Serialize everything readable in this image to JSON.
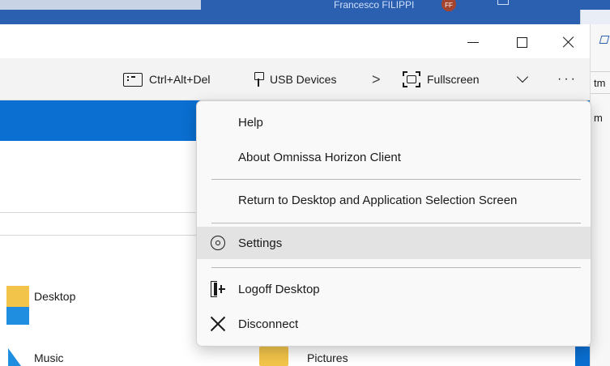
{
  "background": {
    "user_name": "Francesco FILIPPI",
    "avatar_initials": "FF"
  },
  "window": {
    "controls": {
      "minimize": "minimize",
      "maximize": "maximize",
      "close": "close"
    }
  },
  "toolbar": {
    "ctrl_alt_del": "Ctrl+Alt+Del",
    "usb_devices": "USB Devices",
    "separator": ">",
    "fullscreen": "Fullscreen",
    "more": "···"
  },
  "menu": {
    "items": [
      {
        "label": "Help"
      },
      {
        "label": "About Omnissa Horizon Client"
      },
      {
        "label": "Return to Desktop and Application Selection Screen"
      },
      {
        "label": "Settings",
        "icon": "gear-icon",
        "highlighted": true
      },
      {
        "label": "Logoff Desktop",
        "icon": "logoff-icon"
      },
      {
        "label": "Disconnect",
        "icon": "close-icon"
      }
    ]
  },
  "remote_desktop": {
    "files": [
      {
        "label": "Desktop"
      },
      {
        "label": "Music"
      },
      {
        "label": "Pictures"
      }
    ]
  },
  "edge_window": {
    "text_top": "tm",
    "text_bottom": "m"
  },
  "colors": {
    "accent_blue": "#0a6fd1",
    "menu_highlight": "#e3e3e3",
    "toolbar_bg": "#f3f3f3"
  }
}
